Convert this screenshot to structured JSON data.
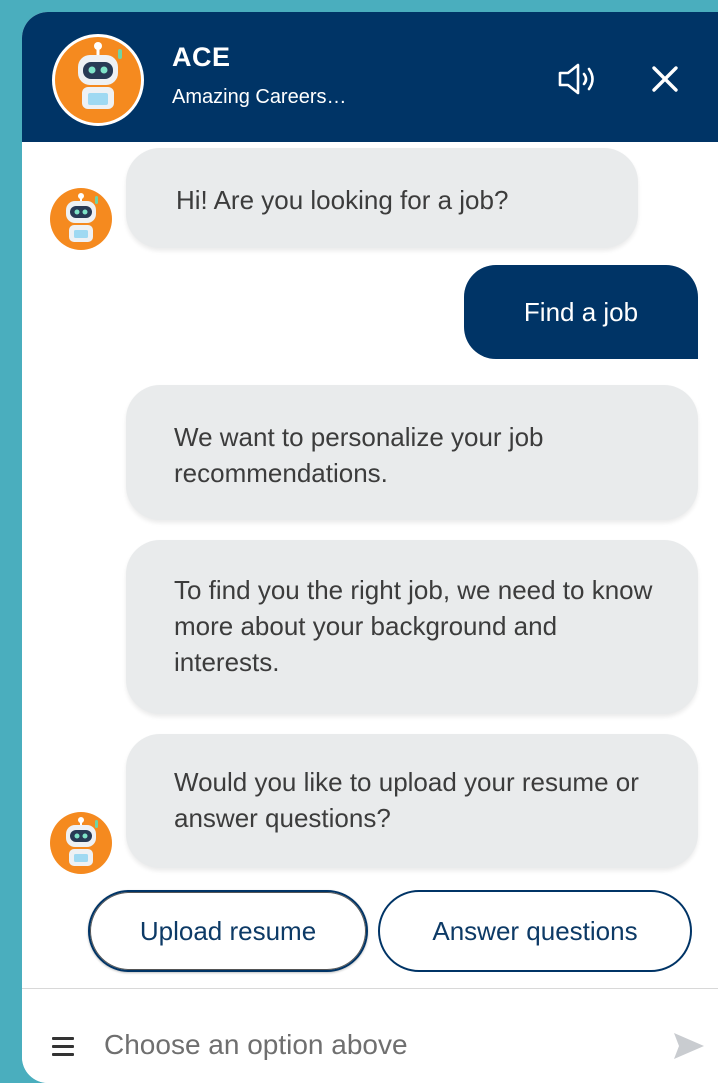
{
  "header": {
    "title": "ACE",
    "subtitle": "Amazing Careers Eve...",
    "accent_color": "#003466",
    "avatar_color": "#f58a1f"
  },
  "messages": [
    {
      "from": "bot",
      "text": "Hi! Are you looking for a job?"
    },
    {
      "from": "user",
      "text": "Find a job"
    },
    {
      "from": "bot",
      "text": "We want to personalize your job recommendations."
    },
    {
      "from": "bot",
      "text": "To find you the right job, we need to know more about your background and interests."
    },
    {
      "from": "bot",
      "text": "Would you like to upload your resume or answer questions?"
    }
  ],
  "quick_replies": [
    "Upload resume",
    "Answer questions"
  ],
  "composer": {
    "placeholder": "Choose an option above"
  },
  "icons": [
    "robot-avatar-icon",
    "speaker-icon",
    "close-icon",
    "menu-icon",
    "send-icon"
  ]
}
